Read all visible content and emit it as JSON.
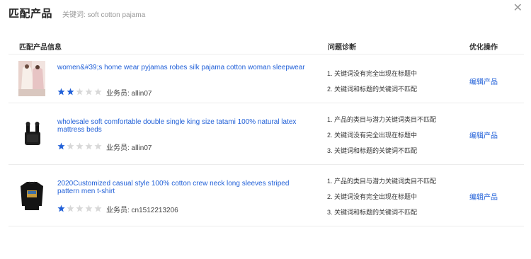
{
  "header": {
    "title": "匹配产品",
    "keyword": "关键词: soft cotton pajama"
  },
  "columns": {
    "info": "匹配产品信息",
    "diag": "问题诊断",
    "op": "优化操作"
  },
  "colors": {
    "link": "#2160d8",
    "star_on": "#2160d8",
    "star_off": "#d8d8d8"
  },
  "rows": [
    {
      "title": "women&#39;s home wear pyjamas robes silk pajama cotton woman sleepwear",
      "stars": 2,
      "seller": "业务员: allin07",
      "issues": [
        "1. 关键词没有完全出现在标题中",
        "2. 关键词和标题的关键词不匹配"
      ],
      "action": "编辑产品",
      "image": "pajama-photo-icon"
    },
    {
      "title": "wholesale soft comfortable double single king size tatami 100% natural latex mattress beds",
      "stars": 1,
      "seller": "业务员: allin07",
      "issues": [
        "1. 产品的类目与潜力关键词类目不匹配",
        "2. 关键词没有完全出现在标题中",
        "3. 关键词和标题的关键词不匹配"
      ],
      "action": "编辑产品",
      "image": "earbuds-photo-icon"
    },
    {
      "title": "2020Customized casual style 100% cotton crew neck long sleeves striped pattern men t-shirt",
      "stars": 1,
      "seller": "业务员: cn1512213206",
      "issues": [
        "1. 产品的类目与潜力关键词类目不匹配",
        "2. 关键词没有完全出现在标题中",
        "3. 关键词和标题的关键词不匹配"
      ],
      "action": "编辑产品",
      "image": "tshirt-photo-icon"
    }
  ]
}
